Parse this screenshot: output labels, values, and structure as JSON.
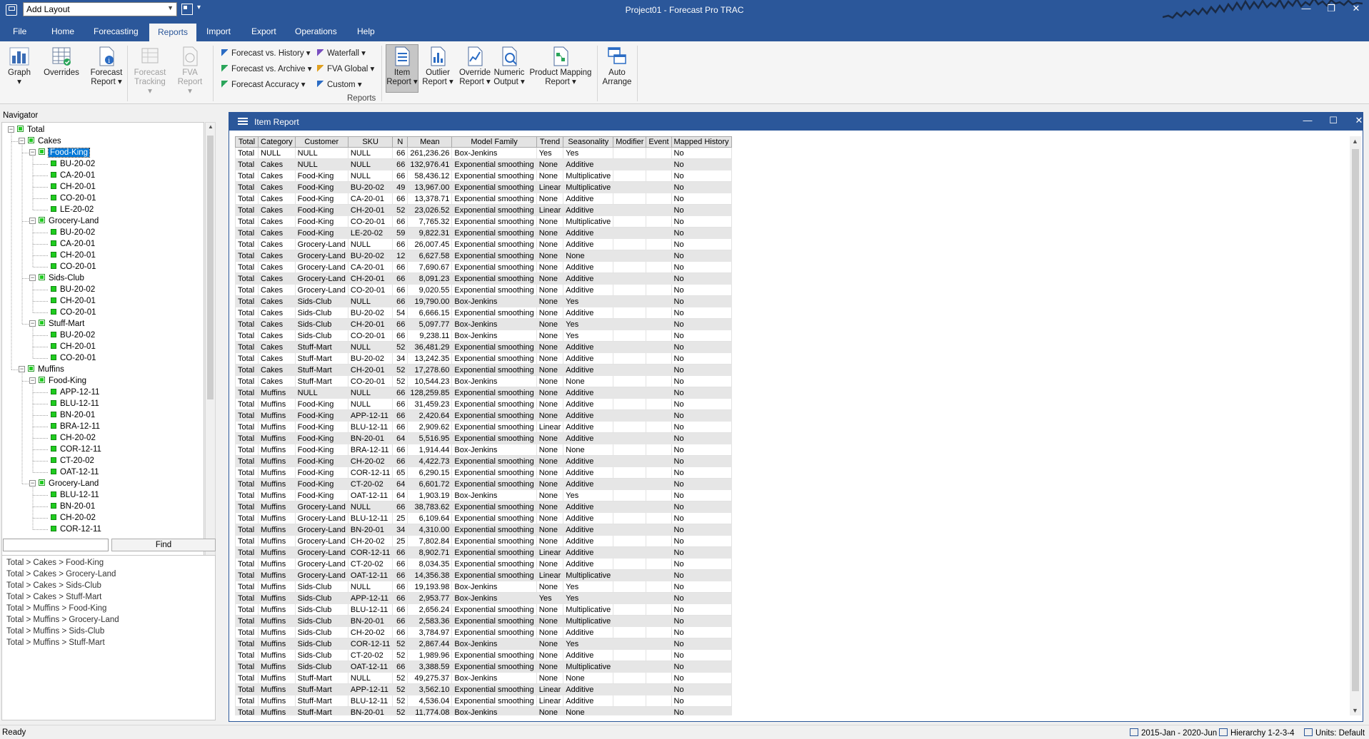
{
  "titlebar": {
    "layout_combo_value": "Add Layout",
    "window_title": "Project01 - Forecast Pro TRAC",
    "minimize": "—",
    "restore": "❐",
    "close": "✕"
  },
  "ribbon_tabs": [
    "File",
    "Home",
    "Forecasting",
    "Reports",
    "Import",
    "Export",
    "Operations",
    "Help"
  ],
  "ribbon": {
    "graph": "Graph",
    "overrides": "Overrides",
    "forecast_report_1": "Forecast",
    "forecast_report_2": "Report",
    "forecast_tracking_1": "Forecast",
    "forecast_tracking_2": "Tracking",
    "fva_report_1": "FVA",
    "fva_report_2": "Report",
    "forecast_vs_history": "Forecast vs. History",
    "forecast_vs_archive": "Forecast vs. Archive",
    "forecast_accuracy": "Forecast Accuracy",
    "waterfall": "Waterfall",
    "fva_global": "FVA Global",
    "custom": "Custom",
    "item_report_1": "Item",
    "item_report_2": "Report",
    "outlier_report_1": "Outlier",
    "outlier_report_2": "Report",
    "override_report_1": "Override",
    "override_report_2": "Report",
    "numeric_output_1": "Numeric",
    "numeric_output_2": "Output",
    "product_mapping_1": "Product Mapping",
    "product_mapping_2": "Report",
    "auto_arrange_1": "Auto",
    "auto_arrange_2": "Arrange",
    "group_label": "Reports"
  },
  "navigator": {
    "title": "Navigator",
    "find_label": "Find",
    "tree": [
      {
        "label": "Total",
        "level": 0,
        "kind": "group"
      },
      {
        "label": "Cakes",
        "level": 1,
        "kind": "group"
      },
      {
        "label": "Food-King",
        "level": 2,
        "kind": "group",
        "selected": true
      },
      {
        "label": "BU-20-02",
        "level": 3,
        "kind": "leaf"
      },
      {
        "label": "CA-20-01",
        "level": 3,
        "kind": "leaf"
      },
      {
        "label": "CH-20-01",
        "level": 3,
        "kind": "leaf"
      },
      {
        "label": "CO-20-01",
        "level": 3,
        "kind": "leaf"
      },
      {
        "label": "LE-20-02",
        "level": 3,
        "kind": "leaf"
      },
      {
        "label": "Grocery-Land",
        "level": 2,
        "kind": "group"
      },
      {
        "label": "BU-20-02",
        "level": 3,
        "kind": "leaf"
      },
      {
        "label": "CA-20-01",
        "level": 3,
        "kind": "leaf"
      },
      {
        "label": "CH-20-01",
        "level": 3,
        "kind": "leaf"
      },
      {
        "label": "CO-20-01",
        "level": 3,
        "kind": "leaf"
      },
      {
        "label": "Sids-Club",
        "level": 2,
        "kind": "group"
      },
      {
        "label": "BU-20-02",
        "level": 3,
        "kind": "leaf"
      },
      {
        "label": "CH-20-01",
        "level": 3,
        "kind": "leaf"
      },
      {
        "label": "CO-20-01",
        "level": 3,
        "kind": "leaf"
      },
      {
        "label": "Stuff-Mart",
        "level": 2,
        "kind": "group"
      },
      {
        "label": "BU-20-02",
        "level": 3,
        "kind": "leaf"
      },
      {
        "label": "CH-20-01",
        "level": 3,
        "kind": "leaf"
      },
      {
        "label": "CO-20-01",
        "level": 3,
        "kind": "leaf"
      },
      {
        "label": "Muffins",
        "level": 1,
        "kind": "group"
      },
      {
        "label": "Food-King",
        "level": 2,
        "kind": "group"
      },
      {
        "label": "APP-12-11",
        "level": 3,
        "kind": "leaf"
      },
      {
        "label": "BLU-12-11",
        "level": 3,
        "kind": "leaf"
      },
      {
        "label": "BN-20-01",
        "level": 3,
        "kind": "leaf"
      },
      {
        "label": "BRA-12-11",
        "level": 3,
        "kind": "leaf"
      },
      {
        "label": "CH-20-02",
        "level": 3,
        "kind": "leaf"
      },
      {
        "label": "COR-12-11",
        "level": 3,
        "kind": "leaf"
      },
      {
        "label": "CT-20-02",
        "level": 3,
        "kind": "leaf"
      },
      {
        "label": "OAT-12-11",
        "level": 3,
        "kind": "leaf"
      },
      {
        "label": "Grocery-Land",
        "level": 2,
        "kind": "group"
      },
      {
        "label": "BLU-12-11",
        "level": 3,
        "kind": "leaf"
      },
      {
        "label": "BN-20-01",
        "level": 3,
        "kind": "leaf"
      },
      {
        "label": "CH-20-02",
        "level": 3,
        "kind": "leaf"
      },
      {
        "label": "COR-12-11",
        "level": 3,
        "kind": "leaf"
      }
    ],
    "paths": [
      "Total > Cakes > Food-King",
      "Total > Cakes > Grocery-Land",
      "Total > Cakes > Sids-Club",
      "Total > Cakes > Stuff-Mart",
      "Total > Muffins > Food-King",
      "Total > Muffins > Grocery-Land",
      "Total > Muffins > Sids-Club",
      "Total > Muffins > Stuff-Mart"
    ]
  },
  "report": {
    "title": "Item Report",
    "columns": [
      "Total",
      "Category",
      "Customer",
      "SKU",
      "N",
      "Mean",
      "Model Family",
      "Trend",
      "Seasonality",
      "Modifier",
      "Event",
      "Mapped History"
    ],
    "rows": [
      [
        "Total",
        "NULL",
        "NULL",
        "NULL",
        "66",
        "261,236.26",
        "Box-Jenkins",
        "Yes",
        "Yes",
        "",
        "",
        "No"
      ],
      [
        "Total",
        "Cakes",
        "NULL",
        "NULL",
        "66",
        "132,976.41",
        "Exponential smoothing",
        "None",
        "Additive",
        "",
        "",
        "No"
      ],
      [
        "Total",
        "Cakes",
        "Food-King",
        "NULL",
        "66",
        "58,436.12",
        "Exponential smoothing",
        "None",
        "Multiplicative",
        "",
        "",
        "No"
      ],
      [
        "Total",
        "Cakes",
        "Food-King",
        "BU-20-02",
        "49",
        "13,967.00",
        "Exponential smoothing",
        "Linear",
        "Multiplicative",
        "",
        "",
        "No"
      ],
      [
        "Total",
        "Cakes",
        "Food-King",
        "CA-20-01",
        "66",
        "13,378.71",
        "Exponential smoothing",
        "None",
        "Additive",
        "",
        "",
        "No"
      ],
      [
        "Total",
        "Cakes",
        "Food-King",
        "CH-20-01",
        "52",
        "23,026.52",
        "Exponential smoothing",
        "Linear",
        "Additive",
        "",
        "",
        "No"
      ],
      [
        "Total",
        "Cakes",
        "Food-King",
        "CO-20-01",
        "66",
        "7,765.32",
        "Exponential smoothing",
        "None",
        "Multiplicative",
        "",
        "",
        "No"
      ],
      [
        "Total",
        "Cakes",
        "Food-King",
        "LE-20-02",
        "59",
        "9,822.31",
        "Exponential smoothing",
        "None",
        "Additive",
        "",
        "",
        "No"
      ],
      [
        "Total",
        "Cakes",
        "Grocery-Land",
        "NULL",
        "66",
        "26,007.45",
        "Exponential smoothing",
        "None",
        "Additive",
        "",
        "",
        "No"
      ],
      [
        "Total",
        "Cakes",
        "Grocery-Land",
        "BU-20-02",
        "12",
        "6,627.58",
        "Exponential smoothing",
        "None",
        "None",
        "",
        "",
        "No"
      ],
      [
        "Total",
        "Cakes",
        "Grocery-Land",
        "CA-20-01",
        "66",
        "7,690.67",
        "Exponential smoothing",
        "None",
        "Additive",
        "",
        "",
        "No"
      ],
      [
        "Total",
        "Cakes",
        "Grocery-Land",
        "CH-20-01",
        "66",
        "8,091.23",
        "Exponential smoothing",
        "None",
        "Additive",
        "",
        "",
        "No"
      ],
      [
        "Total",
        "Cakes",
        "Grocery-Land",
        "CO-20-01",
        "66",
        "9,020.55",
        "Exponential smoothing",
        "None",
        "Additive",
        "",
        "",
        "No"
      ],
      [
        "Total",
        "Cakes",
        "Sids-Club",
        "NULL",
        "66",
        "19,790.00",
        "Box-Jenkins",
        "None",
        "Yes",
        "",
        "",
        "No"
      ],
      [
        "Total",
        "Cakes",
        "Sids-Club",
        "BU-20-02",
        "54",
        "6,666.15",
        "Exponential smoothing",
        "None",
        "Additive",
        "",
        "",
        "No"
      ],
      [
        "Total",
        "Cakes",
        "Sids-Club",
        "CH-20-01",
        "66",
        "5,097.77",
        "Box-Jenkins",
        "None",
        "Yes",
        "",
        "",
        "No"
      ],
      [
        "Total",
        "Cakes",
        "Sids-Club",
        "CO-20-01",
        "66",
        "9,238.11",
        "Box-Jenkins",
        "None",
        "Yes",
        "",
        "",
        "No"
      ],
      [
        "Total",
        "Cakes",
        "Stuff-Mart",
        "NULL",
        "52",
        "36,481.29",
        "Exponential smoothing",
        "None",
        "Additive",
        "",
        "",
        "No"
      ],
      [
        "Total",
        "Cakes",
        "Stuff-Mart",
        "BU-20-02",
        "34",
        "13,242.35",
        "Exponential smoothing",
        "None",
        "Additive",
        "",
        "",
        "No"
      ],
      [
        "Total",
        "Cakes",
        "Stuff-Mart",
        "CH-20-01",
        "52",
        "17,278.60",
        "Exponential smoothing",
        "None",
        "Additive",
        "",
        "",
        "No"
      ],
      [
        "Total",
        "Cakes",
        "Stuff-Mart",
        "CO-20-01",
        "52",
        "10,544.23",
        "Box-Jenkins",
        "None",
        "None",
        "",
        "",
        "No"
      ],
      [
        "Total",
        "Muffins",
        "NULL",
        "NULL",
        "66",
        "128,259.85",
        "Exponential smoothing",
        "None",
        "Additive",
        "",
        "",
        "No"
      ],
      [
        "Total",
        "Muffins",
        "Food-King",
        "NULL",
        "66",
        "31,459.23",
        "Exponential smoothing",
        "None",
        "Additive",
        "",
        "",
        "No"
      ],
      [
        "Total",
        "Muffins",
        "Food-King",
        "APP-12-11",
        "66",
        "2,420.64",
        "Exponential smoothing",
        "None",
        "Additive",
        "",
        "",
        "No"
      ],
      [
        "Total",
        "Muffins",
        "Food-King",
        "BLU-12-11",
        "66",
        "2,909.62",
        "Exponential smoothing",
        "Linear",
        "Additive",
        "",
        "",
        "No"
      ],
      [
        "Total",
        "Muffins",
        "Food-King",
        "BN-20-01",
        "64",
        "5,516.95",
        "Exponential smoothing",
        "None",
        "Additive",
        "",
        "",
        "No"
      ],
      [
        "Total",
        "Muffins",
        "Food-King",
        "BRA-12-11",
        "66",
        "1,914.44",
        "Box-Jenkins",
        "None",
        "None",
        "",
        "",
        "No"
      ],
      [
        "Total",
        "Muffins",
        "Food-King",
        "CH-20-02",
        "66",
        "4,422.73",
        "Exponential smoothing",
        "None",
        "Additive",
        "",
        "",
        "No"
      ],
      [
        "Total",
        "Muffins",
        "Food-King",
        "COR-12-11",
        "65",
        "6,290.15",
        "Exponential smoothing",
        "None",
        "Additive",
        "",
        "",
        "No"
      ],
      [
        "Total",
        "Muffins",
        "Food-King",
        "CT-20-02",
        "64",
        "6,601.72",
        "Exponential smoothing",
        "None",
        "Additive",
        "",
        "",
        "No"
      ],
      [
        "Total",
        "Muffins",
        "Food-King",
        "OAT-12-11",
        "64",
        "1,903.19",
        "Box-Jenkins",
        "None",
        "Yes",
        "",
        "",
        "No"
      ],
      [
        "Total",
        "Muffins",
        "Grocery-Land",
        "NULL",
        "66",
        "38,783.62",
        "Exponential smoothing",
        "None",
        "Additive",
        "",
        "",
        "No"
      ],
      [
        "Total",
        "Muffins",
        "Grocery-Land",
        "BLU-12-11",
        "25",
        "6,109.64",
        "Exponential smoothing",
        "None",
        "Additive",
        "",
        "",
        "No"
      ],
      [
        "Total",
        "Muffins",
        "Grocery-Land",
        "BN-20-01",
        "34",
        "4,310.00",
        "Exponential smoothing",
        "None",
        "Additive",
        "",
        "",
        "No"
      ],
      [
        "Total",
        "Muffins",
        "Grocery-Land",
        "CH-20-02",
        "25",
        "7,802.84",
        "Exponential smoothing",
        "None",
        "Additive",
        "",
        "",
        "No"
      ],
      [
        "Total",
        "Muffins",
        "Grocery-Land",
        "COR-12-11",
        "66",
        "8,902.71",
        "Exponential smoothing",
        "Linear",
        "Additive",
        "",
        "",
        "No"
      ],
      [
        "Total",
        "Muffins",
        "Grocery-Land",
        "CT-20-02",
        "66",
        "8,034.35",
        "Exponential smoothing",
        "None",
        "Additive",
        "",
        "",
        "No"
      ],
      [
        "Total",
        "Muffins",
        "Grocery-Land",
        "OAT-12-11",
        "66",
        "14,356.38",
        "Exponential smoothing",
        "Linear",
        "Multiplicative",
        "",
        "",
        "No"
      ],
      [
        "Total",
        "Muffins",
        "Sids-Club",
        "NULL",
        "66",
        "19,193.98",
        "Box-Jenkins",
        "None",
        "Yes",
        "",
        "",
        "No"
      ],
      [
        "Total",
        "Muffins",
        "Sids-Club",
        "APP-12-11",
        "66",
        "2,953.77",
        "Box-Jenkins",
        "Yes",
        "Yes",
        "",
        "",
        "No"
      ],
      [
        "Total",
        "Muffins",
        "Sids-Club",
        "BLU-12-11",
        "66",
        "2,656.24",
        "Exponential smoothing",
        "None",
        "Multiplicative",
        "",
        "",
        "No"
      ],
      [
        "Total",
        "Muffins",
        "Sids-Club",
        "BN-20-01",
        "66",
        "2,583.36",
        "Exponential smoothing",
        "None",
        "Multiplicative",
        "",
        "",
        "No"
      ],
      [
        "Total",
        "Muffins",
        "Sids-Club",
        "CH-20-02",
        "66",
        "3,784.97",
        "Exponential smoothing",
        "None",
        "Additive",
        "",
        "",
        "No"
      ],
      [
        "Total",
        "Muffins",
        "Sids-Club",
        "COR-12-11",
        "52",
        "2,867.44",
        "Box-Jenkins",
        "None",
        "Yes",
        "",
        "",
        "No"
      ],
      [
        "Total",
        "Muffins",
        "Sids-Club",
        "CT-20-02",
        "52",
        "1,989.96",
        "Exponential smoothing",
        "None",
        "Additive",
        "",
        "",
        "No"
      ],
      [
        "Total",
        "Muffins",
        "Sids-Club",
        "OAT-12-11",
        "66",
        "3,388.59",
        "Exponential smoothing",
        "None",
        "Multiplicative",
        "",
        "",
        "No"
      ],
      [
        "Total",
        "Muffins",
        "Stuff-Mart",
        "NULL",
        "52",
        "49,275.37",
        "Box-Jenkins",
        "None",
        "None",
        "",
        "",
        "No"
      ],
      [
        "Total",
        "Muffins",
        "Stuff-Mart",
        "APP-12-11",
        "52",
        "3,562.10",
        "Exponential smoothing",
        "Linear",
        "Additive",
        "",
        "",
        "No"
      ],
      [
        "Total",
        "Muffins",
        "Stuff-Mart",
        "BLU-12-11",
        "52",
        "4,536.04",
        "Exponential smoothing",
        "Linear",
        "Additive",
        "",
        "",
        "No"
      ],
      [
        "Total",
        "Muffins",
        "Stuff-Mart",
        "BN-20-01",
        "52",
        "11,774.08",
        "Box-Jenkins",
        "None",
        "None",
        "",
        "",
        "No"
      ]
    ]
  },
  "statusbar": {
    "status": "Ready",
    "date_range": "2015-Jan - 2020-Jun",
    "hierarchy": "Hierarchy 1-2-3-4",
    "units": "Units: Default"
  },
  "colors": {
    "accent": "#2b579a",
    "selection": "#0078d7",
    "tree_marker": "#1fcc1f"
  }
}
